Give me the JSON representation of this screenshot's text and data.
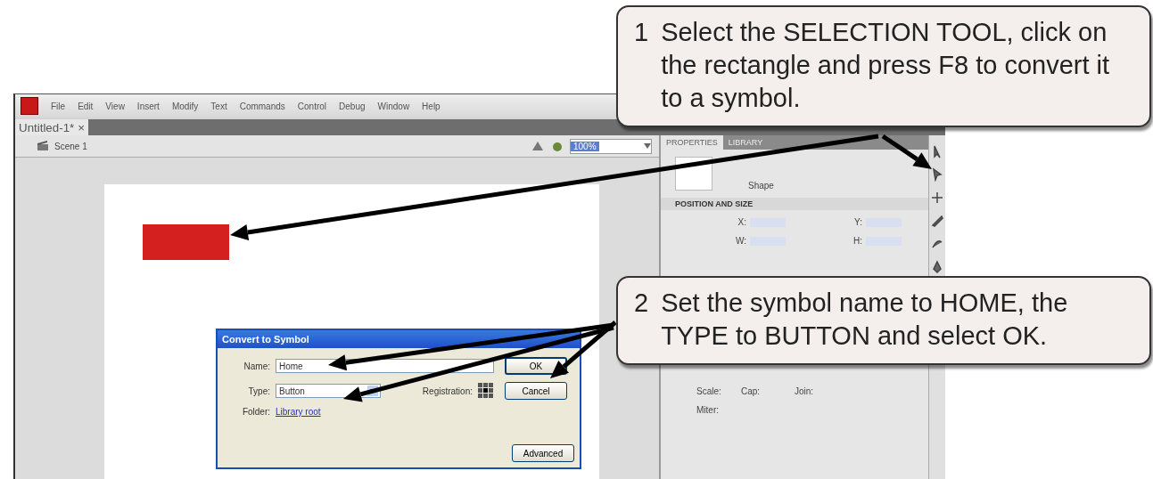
{
  "callouts": [
    {
      "number": "1",
      "text": "Select the SELECTION TOOL, click on the rectangle and press F8 to convert it to a symbol."
    },
    {
      "number": "2",
      "text": "Set the symbol name to HOME, the TYPE to BUTTON and select OK."
    }
  ],
  "app": {
    "menu": [
      "File",
      "Edit",
      "View",
      "Insert",
      "Modify",
      "Text",
      "Commands",
      "Control",
      "Debug",
      "Window",
      "Help"
    ],
    "document_tab": {
      "label": "Untitled-1*",
      "close": "×"
    },
    "scene": "Scene 1",
    "zoom": "100%",
    "properties": {
      "tabs": [
        {
          "label": "PROPERTIES",
          "selected": true
        },
        {
          "label": "LIBRARY",
          "selected": false
        }
      ],
      "shape_label": "Shape",
      "section": "POSITION AND SIZE",
      "position_fields": [
        "X:",
        "Y:",
        "W:",
        "H:"
      ],
      "stroke_fields": [
        "Scale:",
        "Cap:",
        "Join:",
        "Miter:"
      ]
    }
  },
  "dialog": {
    "title": "Convert to Symbol",
    "name_label": "Name:",
    "name_value": "Home",
    "type_label": "Type:",
    "type_value": "Button",
    "registration_label": "Registration:",
    "folder_label": "Folder:",
    "folder_link": "Library root",
    "buttons": [
      "OK",
      "Cancel",
      "Advanced"
    ]
  }
}
